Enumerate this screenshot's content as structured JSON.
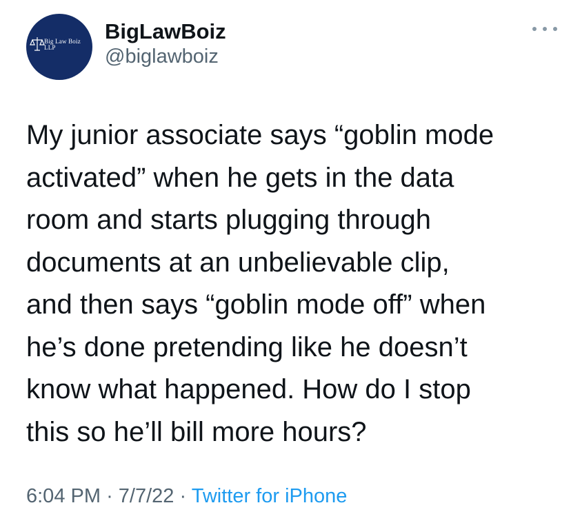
{
  "tweet": {
    "author": {
      "display_name": "BigLawBoiz",
      "handle": "@biglawboiz",
      "avatar_text_line1": "Big Law Boiz",
      "avatar_text_line2": "LLP",
      "avatar_icon": "scales-of-justice-icon"
    },
    "more_icon": "more-options-icon",
    "text": "My junior associate says “goblin mode\nactivated” when he gets in the data\nroom and starts plugging through\ndocuments at an unbelievable clip,\nand then says “goblin mode off” when\nhe’s done pretending like he doesn’t\nknow what happened. How do I stop\nthis so he’ll bill more hours?",
    "time": "6:04 PM",
    "sep1": "·",
    "date": "7/7/22",
    "sep2": "·",
    "source": "Twitter for iPhone"
  },
  "colors": {
    "avatar_bg": "#142d67",
    "text_primary": "#0f1419",
    "text_secondary": "#536471",
    "link": "#1d9bf0"
  }
}
